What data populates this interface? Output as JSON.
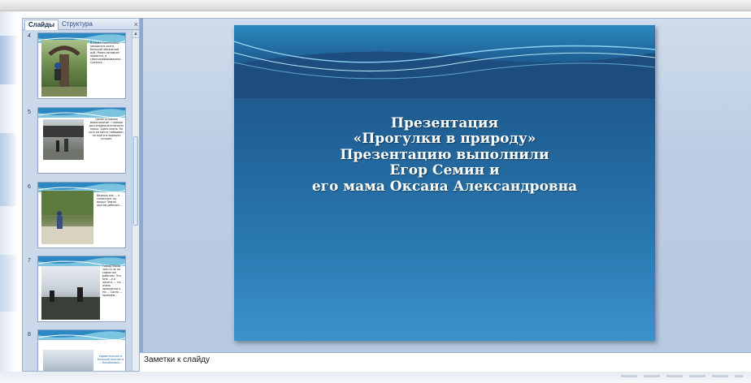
{
  "panel": {
    "tabs": [
      {
        "label": "Слайды",
        "active": true
      },
      {
        "label": "Структура",
        "active": false
      }
    ],
    "close_glyph": "×"
  },
  "thumbnails": [
    {
      "number": "4",
      "text": "В парке Сокольники находится очень большой обожжный дуб. Моим сыновьям нравится, и сфотографировались. Сколько..."
    },
    {
      "number": "5",
      "text": "Самое основное мероприятие - главное достопримечательность парка. Здесь очень. Но хоть на место побывают, но ещё и в хороших лучших."
    },
    {
      "number": "6",
      "text": "Видишь как ... о галактике, но вокруг Земли кругом рабочей..."
    },
    {
      "number": "7",
      "text": "Город/Перед чем-то не на самом же рабочем. Это мне ...я и ничего, ... не ... очень прекрасного. Но ... Сосна ... пройдём..."
    },
    {
      "number": "8",
      "text": "Удивительные и большой фонтан в ... Воробьёвых..."
    }
  ],
  "slide": {
    "title_lines": [
      "Презентация",
      "«Прогулки в природу»",
      "Презентацию выполнили",
      "Егор Семин и",
      "его мама Оксана Александровна"
    ]
  },
  "notes": {
    "placeholder": "Заметки к слайду"
  },
  "colors": {
    "slide_top": "#1d4d7e",
    "slide_bottom": "#3b93c9",
    "panel_bg": "#c7d4e6"
  }
}
